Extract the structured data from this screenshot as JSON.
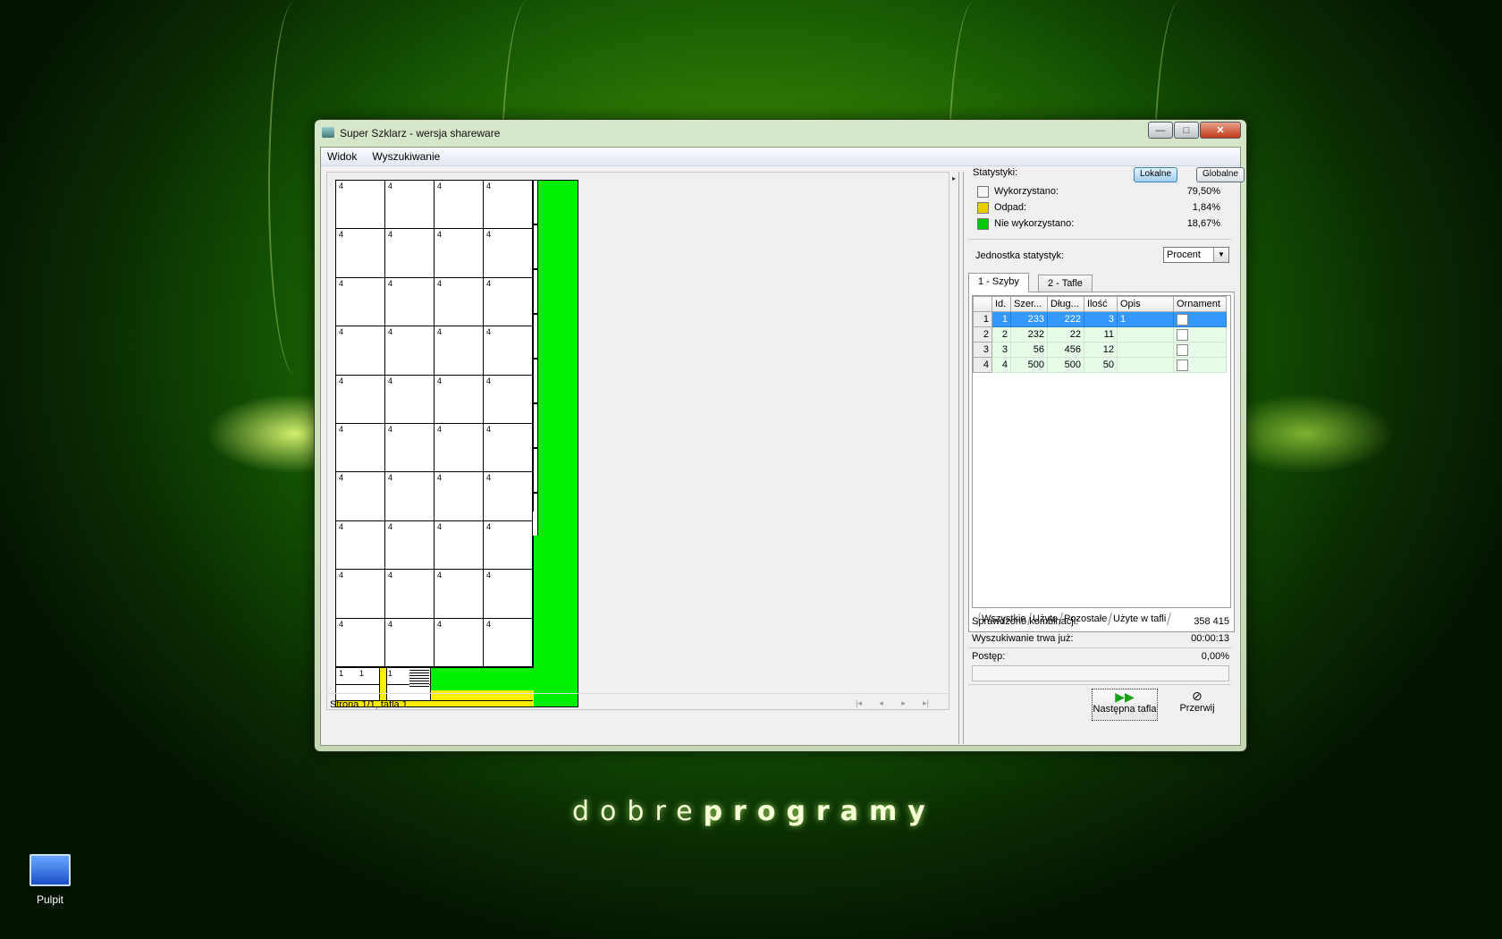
{
  "window": {
    "title": "Super Szklarz - wersja shareware",
    "controls": {
      "minimize": "—",
      "maximize": "□",
      "close": "✕"
    }
  },
  "menu": [
    "Widok",
    "Wyszukiwanie"
  ],
  "canvas": {
    "pane_label": "4",
    "bottom_labels": [
      "1",
      "1",
      "1"
    ],
    "status": "Strona 1/1, tafla 1",
    "pager": [
      "|◂",
      "◂",
      "▸",
      "▸|"
    ]
  },
  "stats": {
    "header": "Statystyki:",
    "btn_local": "Lokalne",
    "btn_global": "Globalne",
    "rows": [
      {
        "name": "Wykorzystano:",
        "value": "79,50%",
        "color": "#f4f4f4"
      },
      {
        "name": "Odpad:",
        "value": "1,84%",
        "color": "#e8d000"
      },
      {
        "name": "Nie wykorzystano:",
        "value": "18,67%",
        "color": "#00cc00"
      }
    ],
    "unit_label": "Jednostka statystyk:",
    "unit_value": "Procent"
  },
  "tabs": [
    "1 - Szyby",
    "2 - Tafle"
  ],
  "table": {
    "columns": [
      "Id.",
      "Szer...",
      "Dług...",
      "Ilość",
      "Opis",
      "Ornament"
    ],
    "rows": [
      {
        "rownum": "1",
        "id": "1",
        "szer": "233",
        "dlug": "222",
        "ilosc": "3",
        "opis": "1",
        "selected": true
      },
      {
        "rownum": "2",
        "id": "2",
        "szer": "232",
        "dlug": "22",
        "ilosc": "11",
        "opis": ""
      },
      {
        "rownum": "3",
        "id": "3",
        "szer": "56",
        "dlug": "456",
        "ilosc": "12",
        "opis": ""
      },
      {
        "rownum": "4",
        "id": "4",
        "szer": "500",
        "dlug": "500",
        "ilosc": "50",
        "opis": ""
      }
    ]
  },
  "filters": [
    "Wszystkie",
    "Użyte",
    "Pozostałe",
    "Użyte w tafli"
  ],
  "info": {
    "checked_label": "Sprawdzono kombinacji:",
    "checked_value": "358 415",
    "time_label": "Wyszukiwanie trwa już:",
    "time_value": "00:00:13",
    "progress_label": "Postęp:",
    "progress_value": "0,00%"
  },
  "actions": {
    "next": "Następna tafla",
    "stop": "Przerwij"
  },
  "desktop": {
    "icon_label": "Pulpit",
    "brand_light": "dobre",
    "brand_bold": "programy"
  }
}
